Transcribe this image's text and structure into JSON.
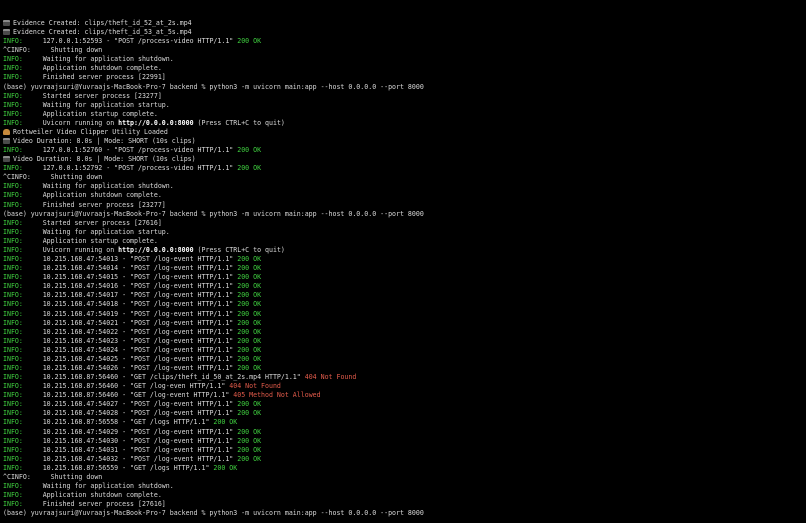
{
  "terminal": {
    "lines": [
      {
        "icon": "clapper-icon",
        "text": "Evidence Created: clips/theft_id_52_at_2s.mp4"
      },
      {
        "icon": "clapper-icon",
        "text": "Evidence Created: clips/theft_id_53_at_5s.mp4"
      },
      {
        "level": "INFO:",
        "text": "     127.0.0.1:52593 - \"POST /process-video HTTP/1.1\" ",
        "status": "200 OK",
        "status_type": "ok"
      },
      {
        "level": "^CINFO:",
        "level_type": "plain",
        "text": "     Shutting down"
      },
      {
        "level": "INFO:",
        "text": "     Waiting for application shutdown."
      },
      {
        "level": "INFO:",
        "text": "     Application shutdown complete."
      },
      {
        "level": "INFO:",
        "text": "     Finished server process [22991]"
      },
      {
        "text": "(base) yuvraajsuri@Yuvraajs-MacBook-Pro-7 backend % python3 -m uvicorn main:app --host 0.0.0.0 --port 8000"
      },
      {
        "level": "INFO:",
        "text": "     Started server process [23277]"
      },
      {
        "level": "INFO:",
        "text": "     Waiting for application startup."
      },
      {
        "level": "INFO:",
        "text": "     Application startup complete."
      },
      {
        "level": "INFO:",
        "text": "     Uvicorn running on ",
        "bold": "http://0.0.0.0:8000",
        "after": " (Press CTRL+C to quit)"
      },
      {
        "icon": "dog-icon",
        "text": "Rottweiler Video Clipper Utility Loaded"
      },
      {
        "icon": "clapper-icon",
        "text": "Video Duration: 8.0s | Mode: SHORT (10s clips)"
      },
      {
        "level": "INFO:",
        "text": "     127.0.0.1:52760 - \"POST /process-video HTTP/1.1\" ",
        "status": "200 OK",
        "status_type": "ok"
      },
      {
        "icon": "clapper-icon",
        "text": "Video Duration: 8.0s | Mode: SHORT (10s clips)"
      },
      {
        "level": "INFO:",
        "text": "     127.0.0.1:52792 - \"POST /process-video HTTP/1.1\" ",
        "status": "200 OK",
        "status_type": "ok"
      },
      {
        "level": "^CINFO:",
        "level_type": "plain",
        "text": "     Shutting down"
      },
      {
        "level": "INFO:",
        "text": "     Waiting for application shutdown."
      },
      {
        "level": "INFO:",
        "text": "     Application shutdown complete."
      },
      {
        "level": "INFO:",
        "text": "     Finished server process [23277]"
      },
      {
        "text": "(base) yuvraajsuri@Yuvraajs-MacBook-Pro-7 backend % python3 -m uvicorn main:app --host 0.0.0.0 --port 8000"
      },
      {
        "level": "INFO:",
        "text": "     Started server process [27616]"
      },
      {
        "level": "INFO:",
        "text": "     Waiting for application startup."
      },
      {
        "level": "INFO:",
        "text": "     Application startup complete."
      },
      {
        "level": "INFO:",
        "text": "     Uvicorn running on ",
        "bold": "http://0.0.0.0:8000",
        "after": " (Press CTRL+C to quit)"
      },
      {
        "level": "INFO:",
        "text": "     10.215.168.47:54013 - \"POST /log-event HTTP/1.1\" ",
        "status": "200 OK",
        "status_type": "ok"
      },
      {
        "level": "INFO:",
        "text": "     10.215.168.47:54014 - \"POST /log-event HTTP/1.1\" ",
        "status": "200 OK",
        "status_type": "ok"
      },
      {
        "level": "INFO:",
        "text": "     10.215.168.47:54015 - \"POST /log-event HTTP/1.1\" ",
        "status": "200 OK",
        "status_type": "ok"
      },
      {
        "level": "INFO:",
        "text": "     10.215.168.47:54016 - \"POST /log-event HTTP/1.1\" ",
        "status": "200 OK",
        "status_type": "ok"
      },
      {
        "level": "INFO:",
        "text": "     10.215.168.47:54017 - \"POST /log-event HTTP/1.1\" ",
        "status": "200 OK",
        "status_type": "ok"
      },
      {
        "level": "INFO:",
        "text": "     10.215.168.47:54018 - \"POST /log-event HTTP/1.1\" ",
        "status": "200 OK",
        "status_type": "ok"
      },
      {
        "level": "INFO:",
        "text": "     10.215.168.47:54019 - \"POST /log-event HTTP/1.1\" ",
        "status": "200 OK",
        "status_type": "ok"
      },
      {
        "level": "INFO:",
        "text": "     10.215.168.47:54021 - \"POST /log-event HTTP/1.1\" ",
        "status": "200 OK",
        "status_type": "ok"
      },
      {
        "level": "INFO:",
        "text": "     10.215.168.47:54022 - \"POST /log-event HTTP/1.1\" ",
        "status": "200 OK",
        "status_type": "ok"
      },
      {
        "level": "INFO:",
        "text": "     10.215.168.47:54023 - \"POST /log-event HTTP/1.1\" ",
        "status": "200 OK",
        "status_type": "ok"
      },
      {
        "level": "INFO:",
        "text": "     10.215.168.47:54024 - \"POST /log-event HTTP/1.1\" ",
        "status": "200 OK",
        "status_type": "ok"
      },
      {
        "level": "INFO:",
        "text": "     10.215.168.47:54025 - \"POST /log-event HTTP/1.1\" ",
        "status": "200 OK",
        "status_type": "ok"
      },
      {
        "level": "INFO:",
        "text": "     10.215.168.47:54026 - \"POST /log-event HTTP/1.1\" ",
        "status": "200 OK",
        "status_type": "ok"
      },
      {
        "level": "INFO:",
        "text": "     10.215.168.87:56460 - \"GET /clips/theft_id_50_at_2s.mp4 HTTP/1.1\" ",
        "status": "404 Not Found",
        "status_type": "err"
      },
      {
        "level": "INFO:",
        "text": "     10.215.168.87:56460 - \"GET /log-even HTTP/1.1\" ",
        "status": "404 Not Found",
        "status_type": "err"
      },
      {
        "level": "INFO:",
        "text": "     10.215.168.87:56460 - \"GET /log-event HTTP/1.1\" ",
        "status": "405 Method Not Allowed",
        "status_type": "err"
      },
      {
        "level": "INFO:",
        "text": "     10.215.168.47:54027 - \"POST /log-event HTTP/1.1\" ",
        "status": "200 OK",
        "status_type": "ok"
      },
      {
        "level": "INFO:",
        "text": "     10.215.168.47:54028 - \"POST /log-event HTTP/1.1\" ",
        "status": "200 OK",
        "status_type": "ok"
      },
      {
        "level": "INFO:",
        "text": "     10.215.168.87:56558 - \"GET /logs HTTP/1.1\" ",
        "status": "200 OK",
        "status_type": "ok"
      },
      {
        "level": "INFO:",
        "text": "     10.215.168.47:54029 - \"POST /log-event HTTP/1.1\" ",
        "status": "200 OK",
        "status_type": "ok"
      },
      {
        "level": "INFO:",
        "text": "     10.215.168.47:54030 - \"POST /log-event HTTP/1.1\" ",
        "status": "200 OK",
        "status_type": "ok"
      },
      {
        "level": "INFO:",
        "text": "     10.215.168.47:54031 - \"POST /log-event HTTP/1.1\" ",
        "status": "200 OK",
        "status_type": "ok"
      },
      {
        "level": "INFO:",
        "text": "     10.215.168.47:54032 - \"POST /log-event HTTP/1.1\" ",
        "status": "200 OK",
        "status_type": "ok"
      },
      {
        "level": "INFO:",
        "text": "     10.215.168.87:56559 - \"GET /logs HTTP/1.1\" ",
        "status": "200 OK",
        "status_type": "ok"
      },
      {
        "level": "^CINFO:",
        "level_type": "plain",
        "text": "     Shutting down"
      },
      {
        "level": "INFO:",
        "text": "     Waiting for application shutdown."
      },
      {
        "level": "INFO:",
        "text": "     Application shutdown complete."
      },
      {
        "level": "INFO:",
        "text": "     Finished server process [27616]"
      },
      {
        "text": "(base) yuvraajsuri@Yuvraajs-MacBook-Pro-7 backend % python3 -m uvicorn main:app --host 0.0.0.0 --port 8000"
      }
    ]
  },
  "colors": {
    "background": "#000000",
    "text": "#d8d8d8",
    "info": "#3fcf3f",
    "ok": "#3fcf3f",
    "error": "#e05a4a"
  }
}
